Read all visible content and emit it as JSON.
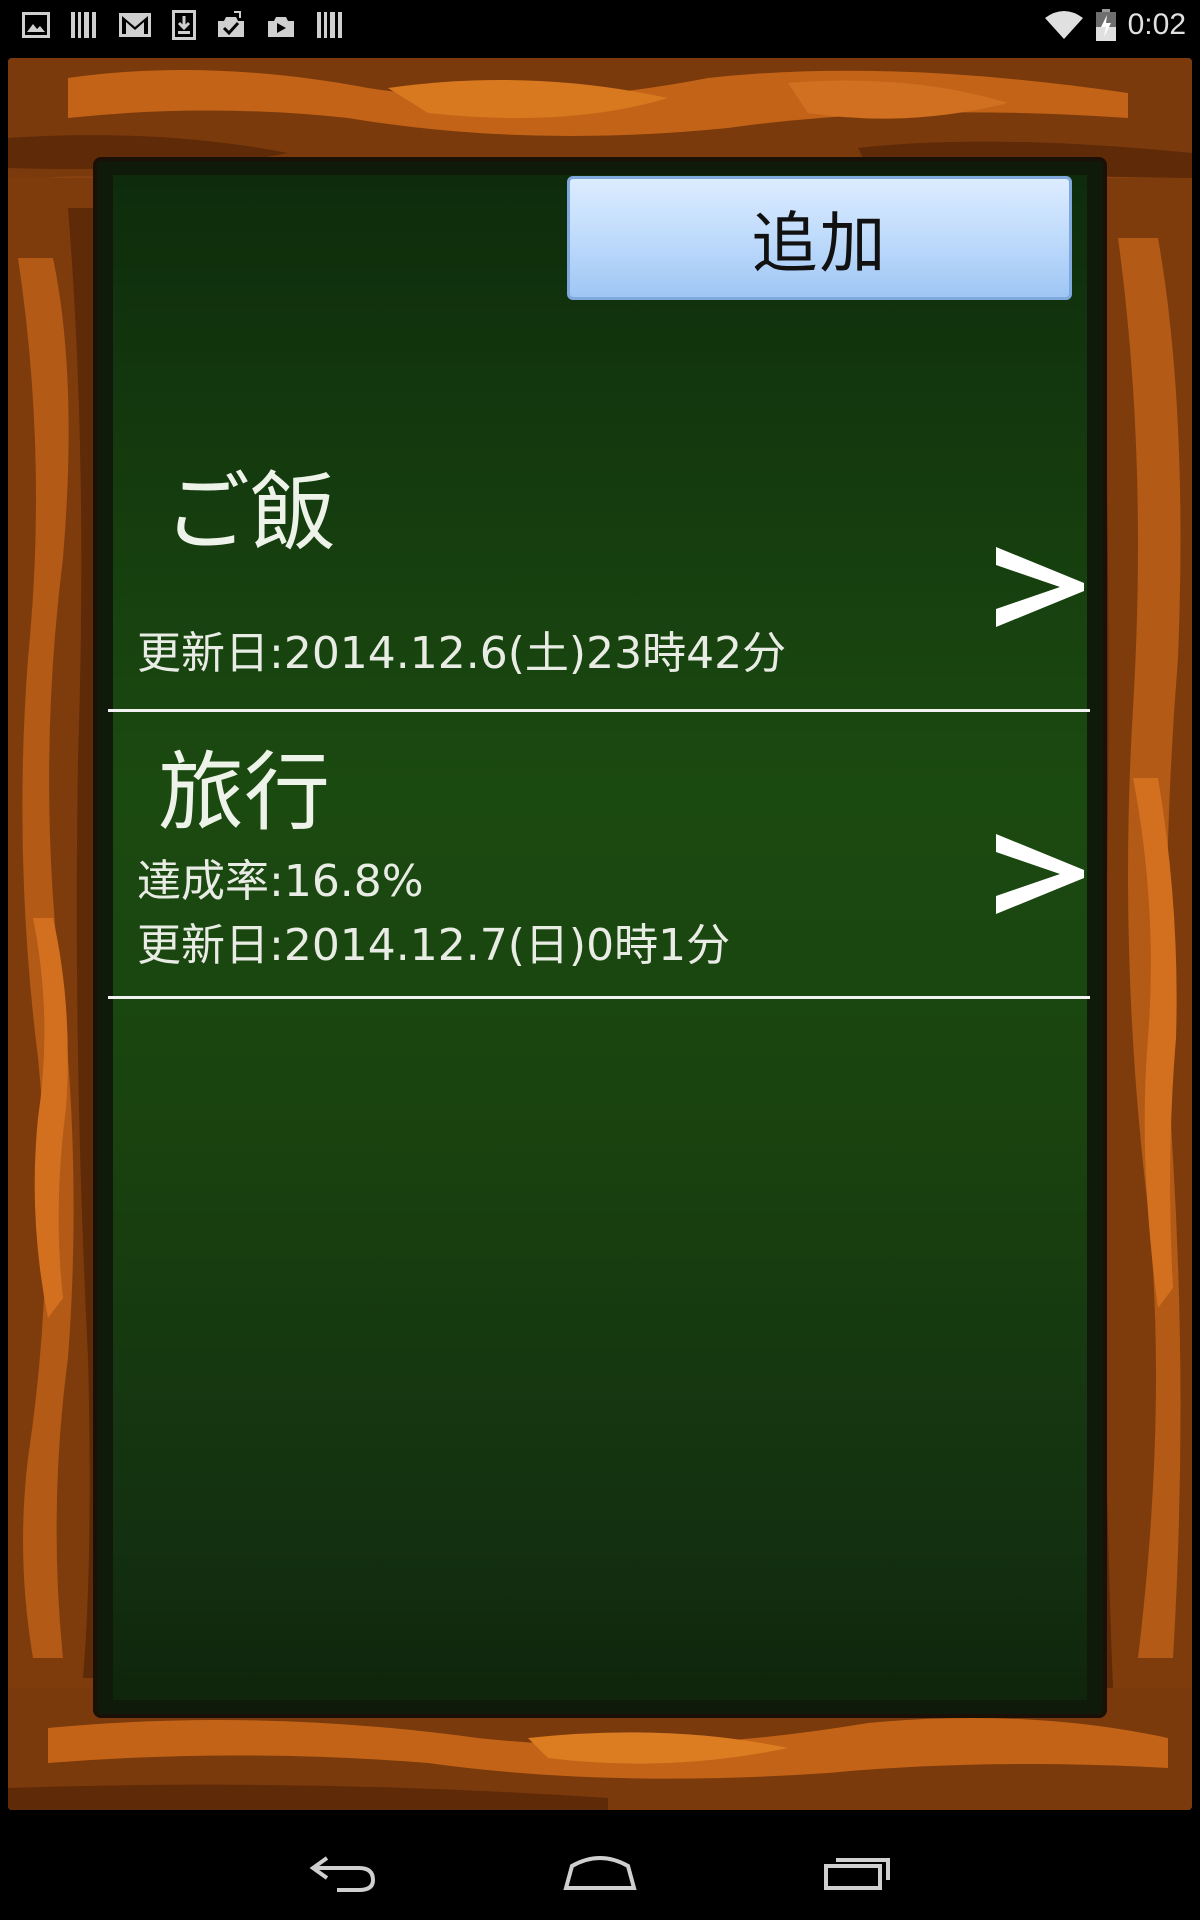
{
  "status_bar": {
    "time": "0:02",
    "left_icons": [
      "image-icon",
      "barcode-icon",
      "gmail-icon",
      "download-icon",
      "task-done-icon",
      "video-upload-icon",
      "barcode-icon"
    ],
    "right_icons": [
      "wifi-icon",
      "battery-charging-icon"
    ]
  },
  "toolbar": {
    "add_label": "追加"
  },
  "list": {
    "items": [
      {
        "title": "ご飯",
        "updated": "更新日:2014.12.6(土)23時42分"
      },
      {
        "title": "旅行",
        "rate": "達成率:16.8%",
        "updated": "更新日:2014.12.7(日)0時1分"
      }
    ],
    "arrow_icon": "chevron-right-icon"
  },
  "nav_bar": {
    "buttons": [
      "back-icon",
      "home-icon",
      "recent-apps-icon"
    ]
  },
  "colors": {
    "board_green": "#1b4a10",
    "wood_dark": "#6a2d08",
    "wood_light": "#c8661a",
    "button_blue": "#bcd9fb"
  }
}
